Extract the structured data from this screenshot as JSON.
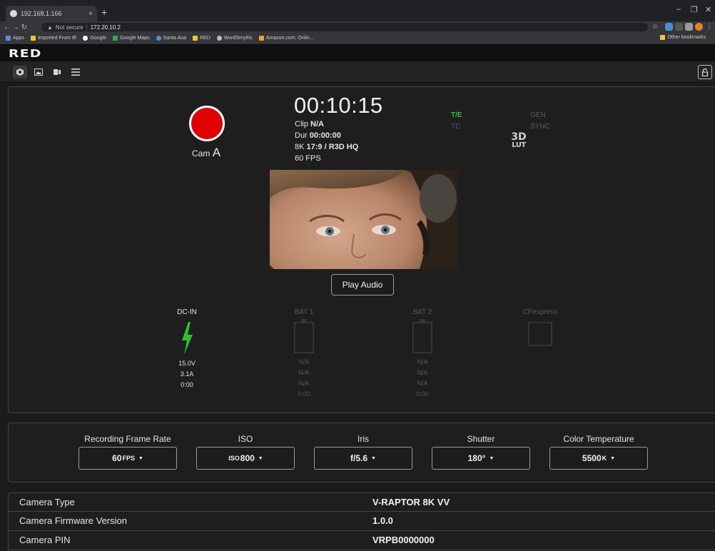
{
  "browser": {
    "tab_title": "192.168.1.166",
    "tab_close": "×",
    "new_tab": "+",
    "win_minimize": "–",
    "win_restore": "❐",
    "win_close": "✕",
    "not_secure": "Not secure",
    "url": "172.20.10.2",
    "bookmarks": [
      "Apps",
      "Imported From IE",
      "Google",
      "Google Maps",
      "Santa Ana",
      "RED",
      "WordSmyths",
      "Amazon.com: Onlin..."
    ],
    "other_bookmarks": "Other bookmarks"
  },
  "app": {
    "logo": "RED",
    "toolbar_icons": [
      "camera-icon",
      "image-icon",
      "media-icon",
      "menu-icon"
    ],
    "lock_icon": "lock-icon"
  },
  "status": {
    "cam_prefix": "Cam",
    "cam_letter": "A",
    "timecode": "00:10:15",
    "clip_label": "Clip",
    "clip_value": "N/A",
    "dur_label": "Dur",
    "dur_value": "00:00:00",
    "format_label": "8K",
    "format_value": "17:9 / R3D HQ",
    "fps": "60 FPS",
    "te": "T/E",
    "tc": "TC",
    "gen": "GEN",
    "sync": "SYNC",
    "lut_line1": "3D",
    "lut_line2": "LUT",
    "play_audio": "Play Audio",
    "accent_green": "#2ec12e",
    "record_color": "#e10000"
  },
  "power": {
    "dcin": {
      "header": "DC-IN",
      "voltage": "15.0V",
      "current": "3.1A",
      "time": "0:00"
    },
    "bat1": {
      "header": "BAT 1",
      "voltage": "N/A",
      "current": "N/A",
      "percent": "N/A",
      "time": "0:00"
    },
    "bat2": {
      "header": "BAT 2",
      "voltage": "N/A",
      "current": "N/A",
      "percent": "N/A",
      "time": "0:00"
    },
    "media": {
      "header": "CFexpress"
    }
  },
  "settings": [
    {
      "label": "Recording Frame Rate",
      "value": "60",
      "unit": "FPS"
    },
    {
      "label": "ISO",
      "value": "800",
      "unit": "ISO"
    },
    {
      "label": "Iris",
      "value": "f/5.6",
      "unit": ""
    },
    {
      "label": "Shutter",
      "value": "180°",
      "unit": ""
    },
    {
      "label": "Color Temperature",
      "value": "5500",
      "unit": "K"
    }
  ],
  "info": [
    {
      "key": "Camera Type",
      "value": "V-RAPTOR 8K VV"
    },
    {
      "key": "Camera Firmware Version",
      "value": "1.0.0"
    },
    {
      "key": "Camera PIN",
      "value": "VRPB0000000"
    }
  ]
}
